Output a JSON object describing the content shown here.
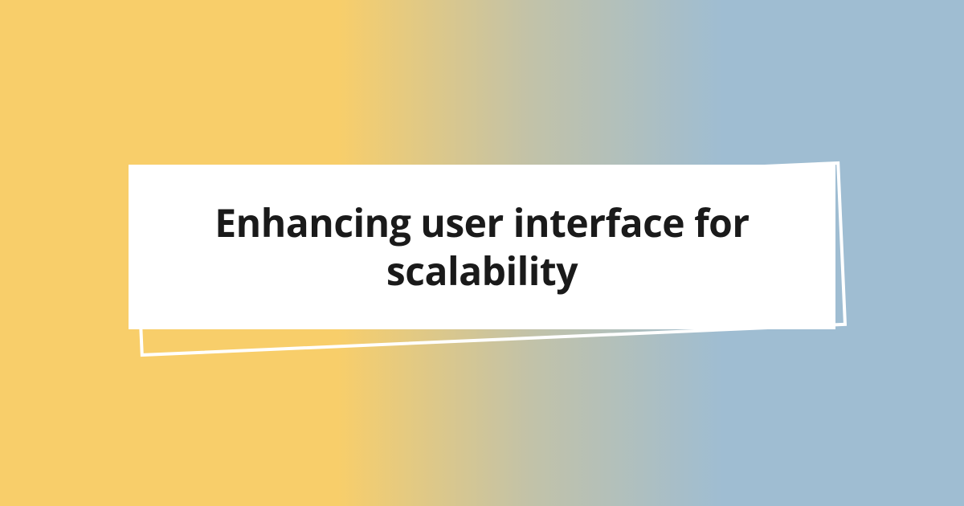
{
  "title": "Enhancing user interface for scalability",
  "colors": {
    "gradient_left": "#f8ce6a",
    "gradient_right": "#9fbdd2",
    "card_bg": "#ffffff",
    "frame_border": "#ffffff",
    "text": "#1a1a1a"
  }
}
